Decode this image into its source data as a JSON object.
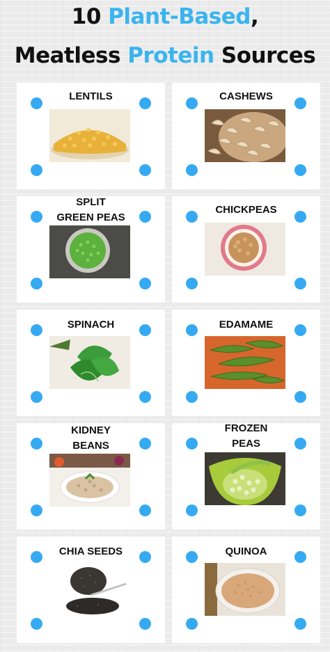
{
  "title": {
    "line1_prefix": "10 ",
    "line1_accent": "Plant-Based",
    "line1_suffix": ",",
    "line2_prefix": "Meatless ",
    "line2_accent": "Protein",
    "line2_suffix": " Sources"
  },
  "accent_color": "#3ab4ee",
  "dot_color": "#35aaf2",
  "items": [
    {
      "label": "LENTILS",
      "icon": "lentils-photo"
    },
    {
      "label": "CASHEWS",
      "icon": "cashews-photo"
    },
    {
      "label": "SPLIT\nGREEN PEAS",
      "icon": "split-green-peas-photo"
    },
    {
      "label": "CHICKPEAS",
      "icon": "chickpeas-photo"
    },
    {
      "label": "SPINACH",
      "icon": "spinach-photo"
    },
    {
      "label": "EDAMAME",
      "icon": "edamame-photo"
    },
    {
      "label": "KIDNEY\nBEANS",
      "icon": "kidney-beans-photo"
    },
    {
      "label": "FROZEN\nPEAS",
      "icon": "frozen-peas-photo"
    },
    {
      "label": "CHIA SEEDS",
      "icon": "chia-seeds-photo"
    },
    {
      "label": "QUINOA",
      "icon": "quinoa-photo"
    }
  ]
}
